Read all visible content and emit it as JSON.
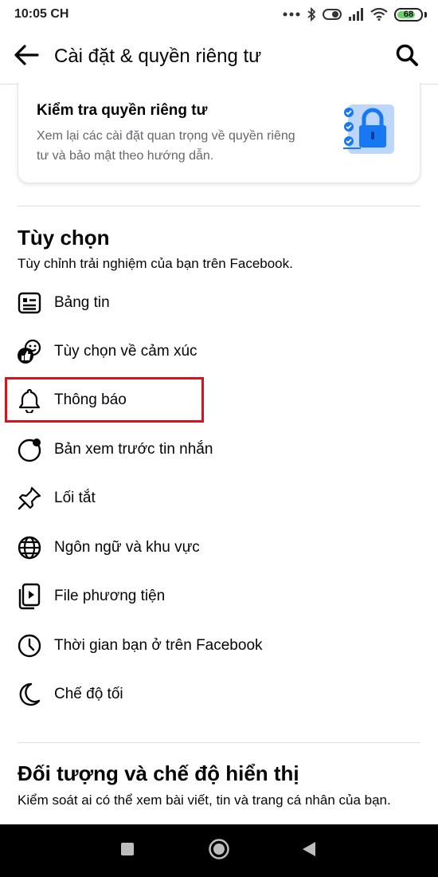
{
  "status_bar": {
    "time": "10:05 CH",
    "battery": "68"
  },
  "header": {
    "title": "Cài đặt & quyền riêng tư",
    "back_icon": "arrow-left-icon",
    "search_icon": "search-icon"
  },
  "privacy_checkup": {
    "title": "Kiểm tra quyền riêng tư",
    "description": "Xem lại các cài đặt quan trọng về quyền riêng tư và bảo mật theo hướng dẫn.",
    "icon": "privacy-lock-checklist-icon"
  },
  "preferences": {
    "title": "Tùy chọn",
    "description": "Tùy chỉnh trải nghiệm của bạn trên Facebook.",
    "items": [
      {
        "label": "Bảng tin",
        "icon": "news-feed-icon"
      },
      {
        "label": "Tùy chọn về cảm xúc",
        "icon": "reactions-icon"
      },
      {
        "label": "Thông báo",
        "icon": "bell-icon",
        "highlighted": true
      },
      {
        "label": "Bản xem trước tin nhắn",
        "icon": "message-preview-icon"
      },
      {
        "label": "Lối tắt",
        "icon": "pin-icon"
      },
      {
        "label": "Ngôn ngữ và khu vực",
        "icon": "globe-icon"
      },
      {
        "label": "File phương tiện",
        "icon": "media-files-icon"
      },
      {
        "label": "Thời gian bạn ở trên Facebook",
        "icon": "clock-icon"
      },
      {
        "label": "Chế độ tối",
        "icon": "moon-icon"
      }
    ]
  },
  "audience": {
    "title": "Đối tượng và chế độ hiển thị",
    "description": "Kiểm soát ai có thể xem bài viết, tin và trang cá nhân của bạn."
  },
  "colors": {
    "highlight": "#e0101a",
    "accent": "#1877f2",
    "nav_bar": "#000000"
  }
}
